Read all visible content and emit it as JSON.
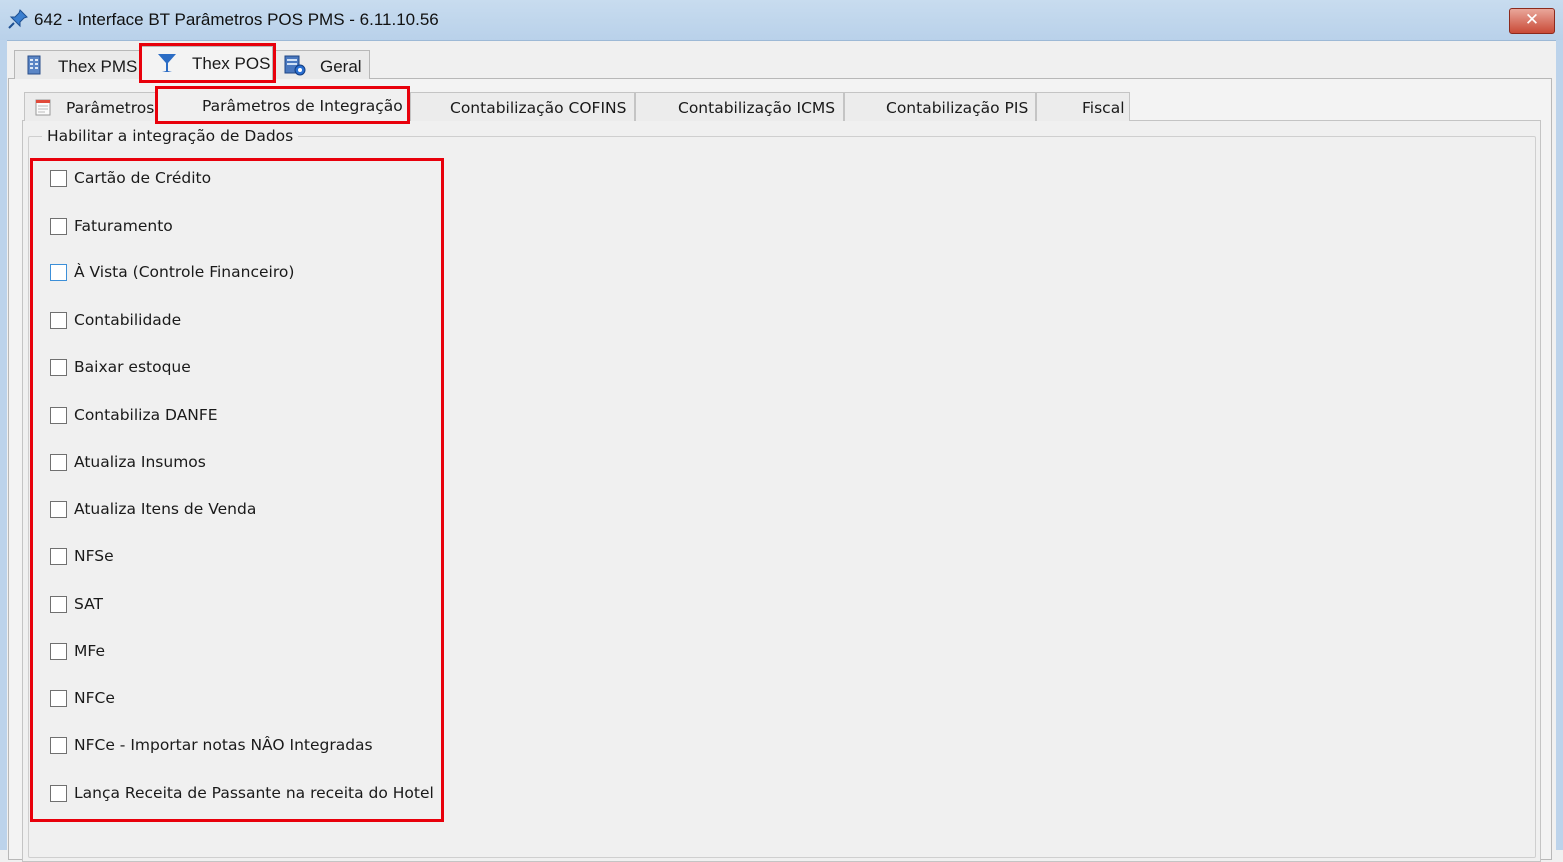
{
  "window": {
    "title": "642 - Interface BT Parâmetros POS PMS - 6.11.10.56",
    "close_label": "✕"
  },
  "outer_tabs": [
    {
      "label": "Thex PMS",
      "icon": "building-icon",
      "active": false
    },
    {
      "label": "Thex POS",
      "icon": "cocktail-glass-icon",
      "active": true
    },
    {
      "label": "Geral",
      "icon": "settings-doc-icon",
      "active": false
    }
  ],
  "inner_tabs": [
    {
      "label": "Parâmetros",
      "icon": "notepad-icon",
      "active": false
    },
    {
      "label": "Parâmetros de Integração",
      "active": true
    },
    {
      "label": "Contabilização COFINS",
      "active": false
    },
    {
      "label": "Contabilização ICMS",
      "active": false
    },
    {
      "label": "Contabilização PIS",
      "active": false
    },
    {
      "label": "Fiscal",
      "active": false
    }
  ],
  "group": {
    "title": "Habilitar a integração de Dados",
    "items": [
      {
        "label": "Cartão de Crédito",
        "checked": false
      },
      {
        "label": "Faturamento",
        "checked": false
      },
      {
        "label": "À Vista (Controle Financeiro)",
        "checked": false,
        "focused": true
      },
      {
        "label": "Contabilidade",
        "checked": false
      },
      {
        "label": "Baixar estoque",
        "checked": false
      },
      {
        "label": "Contabiliza DANFE",
        "checked": false
      },
      {
        "label": "Atualiza Insumos",
        "checked": false
      },
      {
        "label": "Atualiza Itens de Venda",
        "checked": false
      },
      {
        "label": "NFSe",
        "checked": false
      },
      {
        "label": "SAT",
        "checked": false
      },
      {
        "label": "MFe",
        "checked": false
      },
      {
        "label": "NFCe",
        "checked": false
      },
      {
        "label": "NFCe - Importar notas NÂO Integradas",
        "checked": false
      },
      {
        "label": "Lança Receita de Passante na receita do Hotel",
        "checked": false
      }
    ]
  },
  "colors": {
    "highlight": "#e8000b",
    "titlebar": "#b9d1ea",
    "accent_icon": "#2b6cc4"
  }
}
